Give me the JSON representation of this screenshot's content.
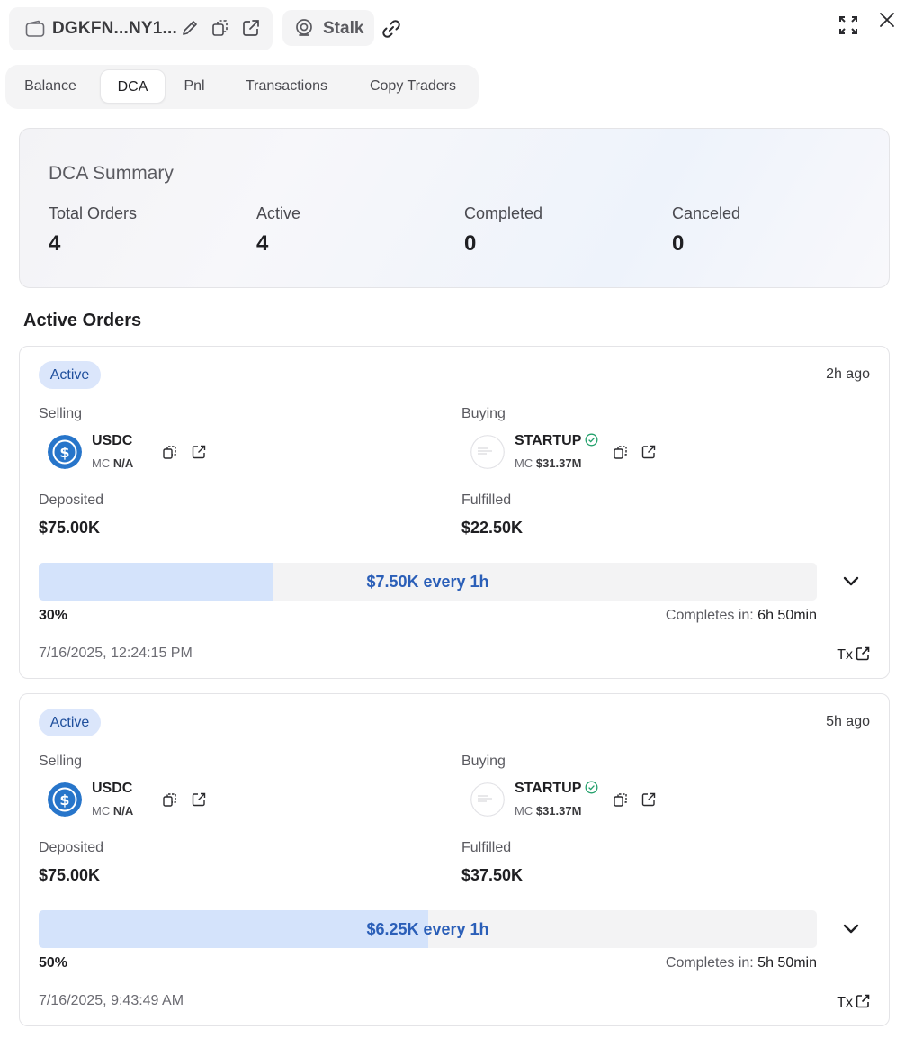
{
  "header": {
    "wallet_address": "DGKFN...NY1...",
    "stalk_label": "Stalk"
  },
  "tabs": [
    {
      "label": "Balance",
      "active": false
    },
    {
      "label": "DCA",
      "active": true
    },
    {
      "label": "Pnl",
      "active": false
    },
    {
      "label": "Transactions",
      "active": false
    },
    {
      "label": "Copy Traders",
      "active": false
    }
  ],
  "summary": {
    "title": "DCA Summary",
    "stats": [
      {
        "label": "Total Orders",
        "value": "4"
      },
      {
        "label": "Active",
        "value": "4"
      },
      {
        "label": "Completed",
        "value": "0"
      },
      {
        "label": "Canceled",
        "value": "0"
      }
    ]
  },
  "section_title": "Active Orders",
  "orders": [
    {
      "status": "Active",
      "ago": "2h ago",
      "selling_label": "Selling",
      "selling_token": "USDC",
      "selling_mc_label": "MC",
      "selling_mc": "N/A",
      "buying_label": "Buying",
      "buying_token": "STARTUP",
      "buying_mc_label": "MC",
      "buying_mc": "$31.37M",
      "deposited_label": "Deposited",
      "deposited": "$75.00K",
      "fulfilled_label": "Fulfilled",
      "fulfilled": "$22.50K",
      "progress": 0.3,
      "schedule": "$7.50K every 1h",
      "percent": "30%",
      "completes_label": "Completes in:",
      "completes_value": "6h 50min",
      "date": "7/16/2025, 12:24:15 PM",
      "tx_label": "Tx"
    },
    {
      "status": "Active",
      "ago": "5h ago",
      "selling_label": "Selling",
      "selling_token": "USDC",
      "selling_mc_label": "MC",
      "selling_mc": "N/A",
      "buying_label": "Buying",
      "buying_token": "STARTUP",
      "buying_mc_label": "MC",
      "buying_mc": "$31.37M",
      "deposited_label": "Deposited",
      "deposited": "$75.00K",
      "fulfilled_label": "Fulfilled",
      "fulfilled": "$37.50K",
      "progress": 0.5,
      "schedule": "$6.25K every 1h",
      "percent": "50%",
      "completes_label": "Completes in:",
      "completes_value": "5h 50min",
      "date": "7/16/2025, 9:43:49 AM",
      "tx_label": "Tx"
    }
  ],
  "colors": {
    "badge_bg": "#dbe6fb",
    "badge_text": "#1f4f9c",
    "progress_fill": "#d4e3fb",
    "progress_track": "#f3f3f4",
    "schedule_text": "#2b5fb8",
    "usdc_blue": "#2775ca",
    "verified_green": "#22a06b"
  },
  "icons": [
    "wallet-icon",
    "edit-icon",
    "copy-icon",
    "external-link-icon",
    "stalk-icon",
    "link-icon",
    "expand-icon",
    "close-icon",
    "usdc-logo",
    "startup-logo",
    "verified-icon",
    "chevron-down-icon"
  ]
}
